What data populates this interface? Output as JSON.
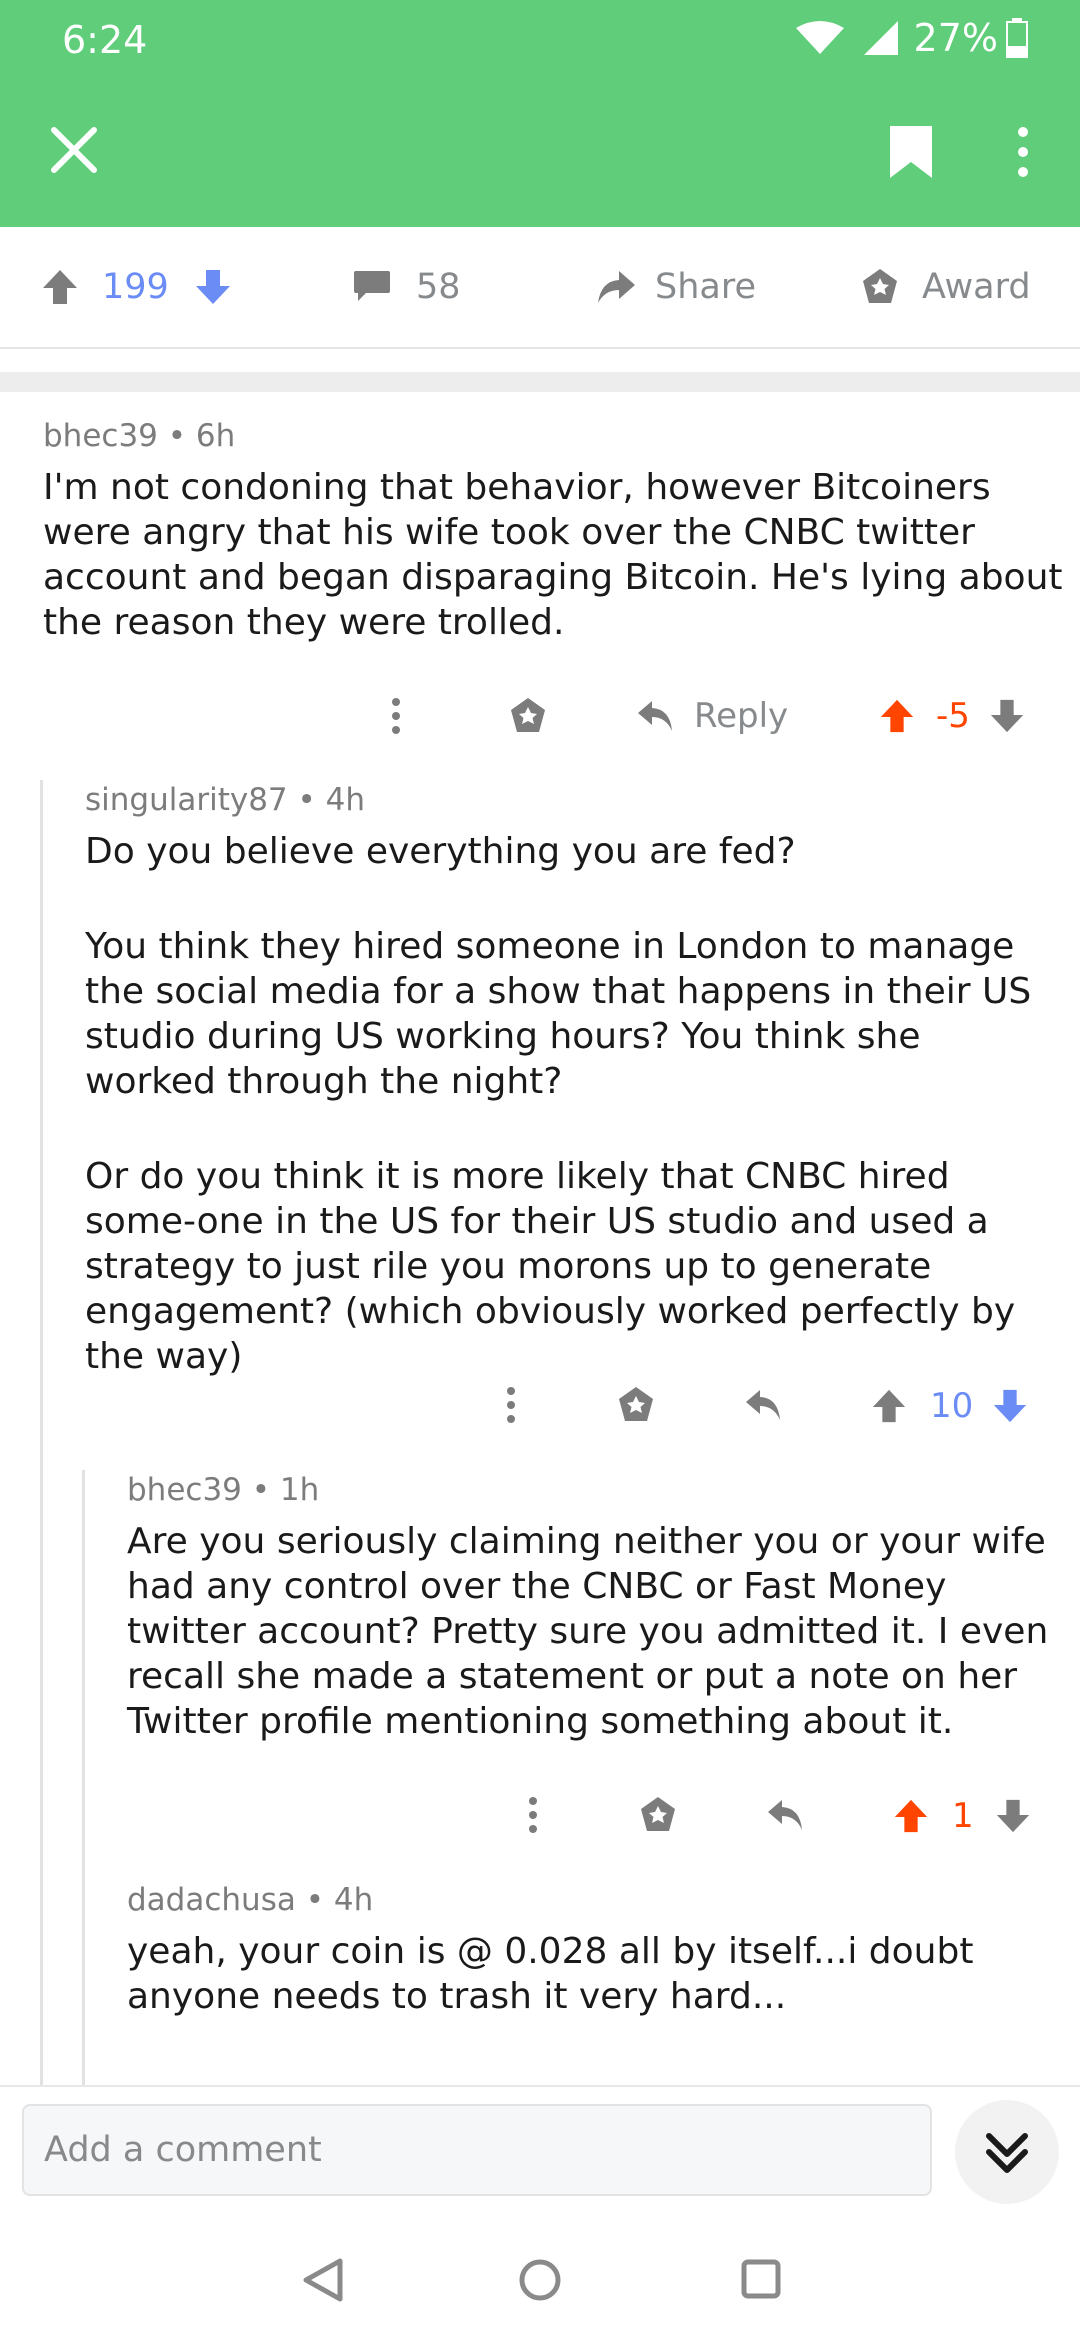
{
  "status_bar": {
    "time": "6:24",
    "battery": "27%"
  },
  "post_actions": {
    "score": "199",
    "comments": "58",
    "share_label": "Share",
    "award_label": "Award"
  },
  "comments": [
    {
      "author": "bhec39",
      "age": "6h",
      "paragraphs": [
        "I'm not condoning that behavior, however Bitcoiners were angry that his wife took over the CNBC twitter account and began disparaging Bitcoin. He's lying about the reason they were trolled."
      ],
      "reply_label": "Reply",
      "score": "-5"
    },
    {
      "author": "singularity87",
      "age": "4h",
      "paragraphs": [
        "Do you believe everything you are fed?",
        "You think they hired someone in London to manage the social media for a show that happens in their US studio during US working hours? You think she worked through the night?",
        "Or do you think it is more likely that CNBC hired some-one in the US for their US studio and used a strategy to just rile you morons up to generate engagement? (which obviously worked perfectly by the way)"
      ],
      "score": "10"
    },
    {
      "author": "bhec39",
      "age": "1h",
      "paragraphs": [
        "Are you seriously claiming neither you or your wife had any control over the CNBC or Fast Money twitter account? Pretty sure you admitted it. I even recall she made a statement or put a note on her Twitter profile mentioning something about it."
      ],
      "score": "1"
    },
    {
      "author": "dadachusa",
      "age": "4h",
      "paragraphs": [
        "yeah, your coin is @ 0.028 all by itself...i doubt anyone needs to trash it very hard..."
      ]
    }
  ],
  "comment_input": {
    "placeholder": "Add a comment"
  },
  "separator": "•"
}
